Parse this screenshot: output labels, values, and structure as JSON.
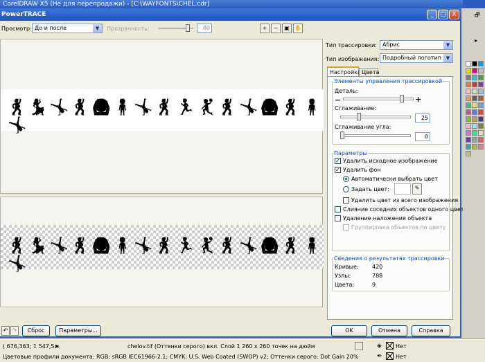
{
  "app_title": "CorelDRAW X5 (Не для перепродажи) - [C:\\WAYFONTS\\CHEL.cdr]",
  "dialog_title": "PowerTRACE",
  "preview": {
    "label": "Просмотр:",
    "value": "До и после"
  },
  "transparency": {
    "label": "Прозрачность:",
    "value": "80"
  },
  "trace_type": {
    "label": "Тип трассировки:",
    "value": "Абрис"
  },
  "image_type": {
    "label": "Тип изображения:",
    "value": "Подробный логотип"
  },
  "tabs": [
    "Настройка",
    "Цвета"
  ],
  "controls_group": {
    "title": "Элементы управления трассировкой",
    "detail": "Деталь:",
    "smoothing": "Сглаживание:",
    "smoothing_value": "25",
    "corner": "Сглаживание угла:",
    "corner_value": "0",
    "detail_level": 0.85,
    "smoothing_level": 0.25,
    "corner_level": 0
  },
  "params_group": {
    "title": "Параметры",
    "delete_original": "Удалить исходное изображение",
    "remove_bg": "Удалить фон",
    "auto_color": "Автоматически выбрать цвет",
    "set_color": "Задать цвет:",
    "remove_color_all": "Удалить цвет из всего изображения",
    "merge_adjacent": "Слияние соседних объектов одного цвета",
    "remove_overlap": "Удаление наложения объекта",
    "group_by_color": "Группировка объектов по цвету"
  },
  "results_group": {
    "title": "Сведения о результатах трассировки",
    "curves_label": "Кривые:",
    "curves_value": "420",
    "nodes_label": "Узлы:",
    "nodes_value": "788",
    "colors_label": "Цвета:",
    "colors_value": "9"
  },
  "buttons": {
    "reset": "Сброс",
    "options": "Параметры...",
    "ok": "OK",
    "cancel": "Отмена",
    "help": "Справка"
  },
  "window_controls": [
    "_",
    "□",
    "X"
  ],
  "zoom_tools": [
    "zoom-in-icon",
    "zoom-out-icon",
    "fit-icon",
    "hand-icon"
  ],
  "status": {
    "coords": "( 676,363; 1 547,5...",
    "object_info": "chelov.tif (Оттенки серого) вкл. Слой 1 260 x 260 точек на дюйм",
    "color_profiles": "Цветовые профили документа: RGB: sRGB IEC61966-2.1; CMYK: U.S. Web Coated (SWOP) v2; Оттенки серого: Dot Gain 20%",
    "fill_none": "Нет",
    "outline_none": "Нет"
  },
  "figures": "🕺💃🤸🕺🙆🧍🤸🕺🏃🤾🕺🤸🙆🕺🧍🤸",
  "palette_colors": [
    "#ffffff",
    "#000000",
    "#00a0e0",
    "#e0e000",
    "#e00080",
    "#c0c0c0",
    "#808080",
    "#40c0c0",
    "#40a040",
    "#e08040",
    "#c04040",
    "#8040a0",
    "#f0c0c0",
    "#c0e0c0",
    "#a0c0e0",
    "#e0a060",
    "#606060",
    "#a06040",
    "#40c080",
    "#e0e080",
    "#80a0c0",
    "#c06080",
    "#6080e0",
    "#e04040",
    "#80c040",
    "#c0a060",
    "#404080",
    "#e0c0e0",
    "#a0e0e0",
    "#808040",
    "#c080c0",
    "#40e0a0",
    "#e0e0c0",
    "#6040a0",
    "#a0a0a0",
    "#e06060",
    "#40a0a0",
    "#a0c040",
    "#e080a0",
    "#c0c080"
  ]
}
